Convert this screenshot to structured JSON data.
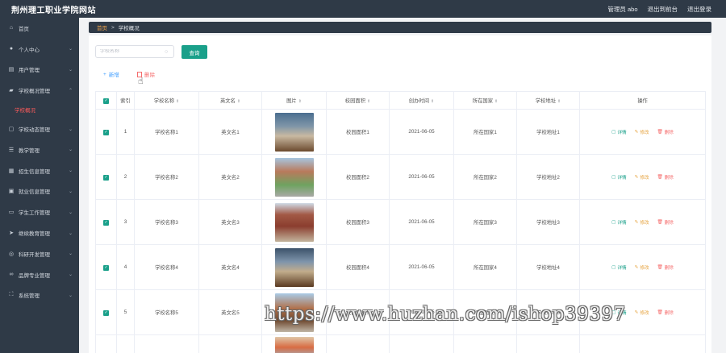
{
  "header": {
    "title": "荆州理工职业学院网站",
    "admin": "管理员 abo",
    "exit_backend": "退出到前台",
    "logout": "退出登录"
  },
  "sidebar": {
    "items": [
      {
        "label": "首页",
        "icon": "home-icon"
      },
      {
        "label": "个人中心",
        "icon": "user-icon"
      },
      {
        "label": "用户管理",
        "icon": "doc-icon"
      },
      {
        "label": "学校概况管理",
        "icon": "school-icon",
        "submenu": [
          "学校概况"
        ]
      },
      {
        "label": "学校动态管理",
        "icon": "chat-icon"
      },
      {
        "label": "教学管理",
        "icon": "sliders-icon"
      },
      {
        "label": "招生信息管理",
        "icon": "grid-icon"
      },
      {
        "label": "就业信息管理",
        "icon": "briefcase-icon"
      },
      {
        "label": "学生工作管理",
        "icon": "monitor-icon"
      },
      {
        "label": "继续教育管理",
        "icon": "send-icon"
      },
      {
        "label": "科研开发管理",
        "icon": "target-icon"
      },
      {
        "label": "品牌专业管理",
        "icon": "link-icon"
      },
      {
        "label": "系统管理",
        "icon": "expand-icon"
      }
    ]
  },
  "breadcrumb": {
    "home": "首页",
    "separator": ">",
    "current": "学校概况"
  },
  "search": {
    "placeholder": "学校名称",
    "button": "查询"
  },
  "actions": {
    "add": "新增",
    "delete": "删除"
  },
  "table": {
    "headers": [
      "索引",
      "学校名称",
      "英文名",
      "图片",
      "校园面积",
      "创办时间",
      "所在国家",
      "学校地址",
      "操作"
    ],
    "rows": [
      {
        "index": "1",
        "name": "学校名称1",
        "english": "英文名1",
        "area": "校园面积1",
        "founded": "2021-06-05",
        "country": "所在国家1",
        "address": "学校地址1"
      },
      {
        "index": "2",
        "name": "学校名称2",
        "english": "英文名2",
        "area": "校园面积2",
        "founded": "2021-06-05",
        "country": "所在国家2",
        "address": "学校地址2"
      },
      {
        "index": "3",
        "name": "学校名称3",
        "english": "英文名3",
        "area": "校园面积3",
        "founded": "2021-06-05",
        "country": "所在国家3",
        "address": "学校地址3"
      },
      {
        "index": "4",
        "name": "学校名称4",
        "english": "英文名4",
        "area": "校园面积4",
        "founded": "2021-06-05",
        "country": "所在国家4",
        "address": "学校地址4"
      },
      {
        "index": "5",
        "name": "学校名称5",
        "english": "英文名5",
        "area": "校园面积5",
        "founded": "2021-06-05",
        "country": "所在国家5",
        "address": "学校地址5"
      }
    ],
    "ops": {
      "detail": "详情",
      "edit": "修改",
      "delete": "删除"
    }
  },
  "watermark": "https://www.huzhan.com/ishop39397",
  "colors": {
    "sidebar": "#2f3a47",
    "accent": "#1aa08a",
    "danger": "#f56c6c",
    "warning": "#e6a23c",
    "link": "#409eff",
    "breadcrumb_home": "#f0a34b"
  }
}
